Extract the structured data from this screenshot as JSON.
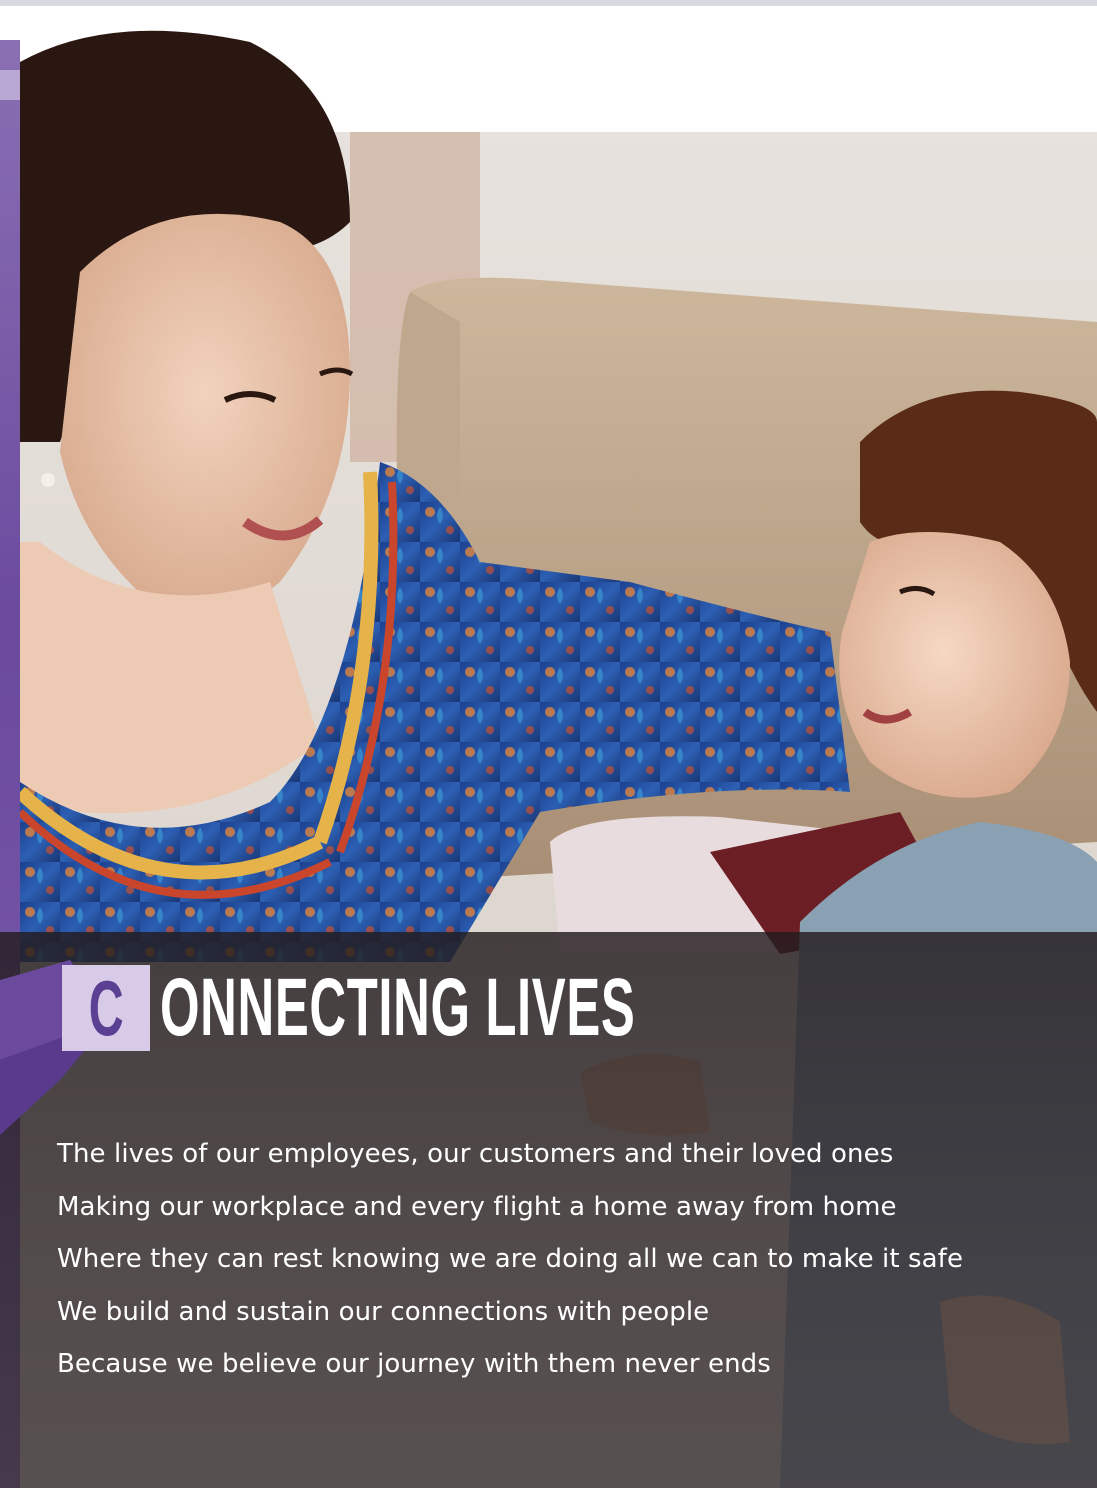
{
  "heading": {
    "initial": "C",
    "rest": "ONNECTING LIVES"
  },
  "body_lines": [
    "The lives of our employees, our customers and their loved ones",
    "Making our workplace and every flight a home away from home",
    "Where they can rest knowing we are doing all we can to make it safe",
    "We build and sustain our connections with people",
    "Because we believe our journey with them never ends"
  ],
  "colors": {
    "accent_purple": "#6b4a9e",
    "initial_box": "#d7cbe8",
    "initial_text": "#5b3f93",
    "caption_overlay": "#2d2628"
  }
}
